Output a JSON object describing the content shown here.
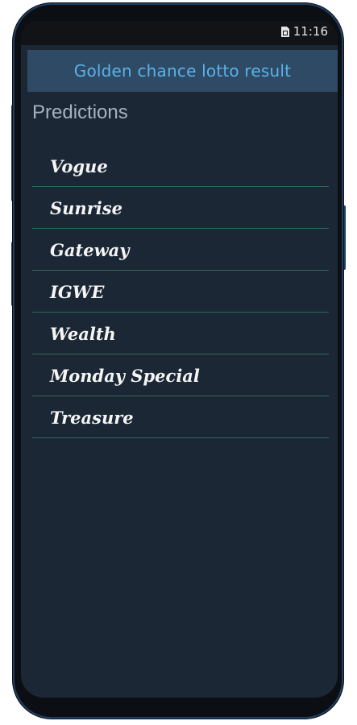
{
  "status_bar": {
    "time": "11:16",
    "icons": [
      "sim-icon"
    ]
  },
  "toolbar": {
    "title": "Golden chance lotto result"
  },
  "section": {
    "header": "Predictions"
  },
  "predictions": {
    "items": [
      {
        "label": "Vogue"
      },
      {
        "label": "Sunrise"
      },
      {
        "label": "Gateway"
      },
      {
        "label": "IGWE"
      },
      {
        "label": "Wealth"
      },
      {
        "label": "Monday Special"
      },
      {
        "label": "Treasure"
      }
    ]
  },
  "colors": {
    "background": "#1c2735",
    "toolbar": "#2f4a65",
    "title_text": "#5bb2eb",
    "divider": "#2b6a54",
    "item_text": "#f5f5f5",
    "header_text": "#a8b2bf"
  }
}
